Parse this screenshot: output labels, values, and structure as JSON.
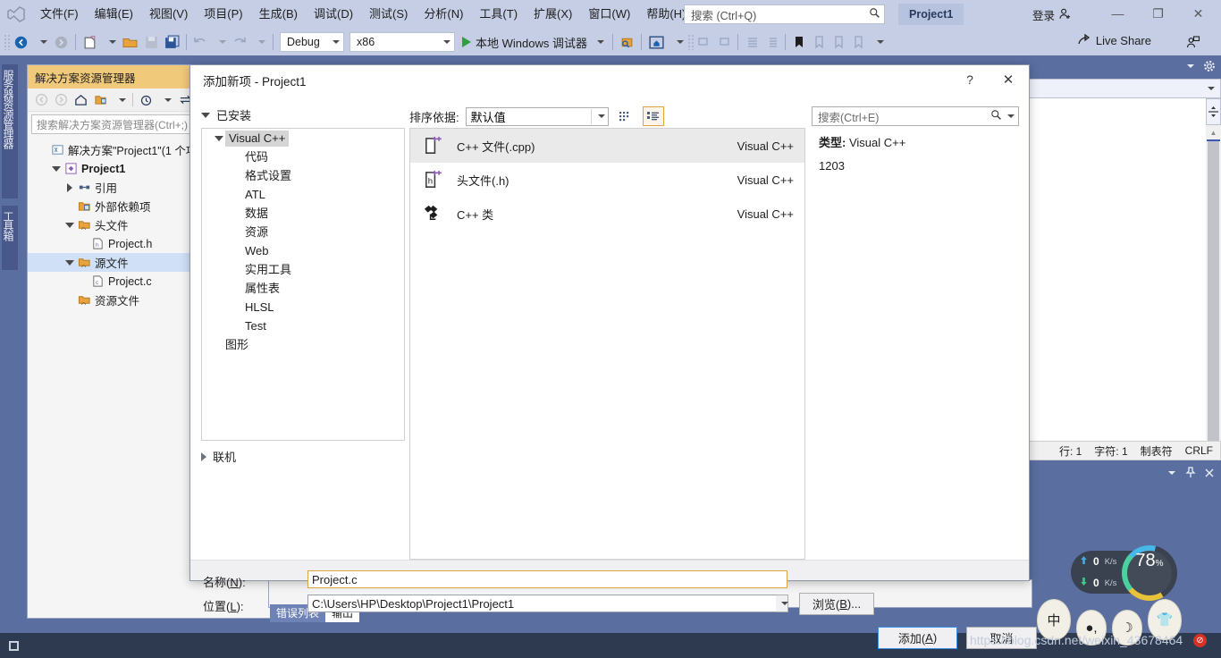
{
  "menubar": {
    "logo_icon": "visual-studio-logo",
    "items": [
      {
        "label": "文件(F)"
      },
      {
        "label": "编辑(E)"
      },
      {
        "label": "视图(V)"
      },
      {
        "label": "项目(P)"
      },
      {
        "label": "生成(B)"
      },
      {
        "label": "调试(D)"
      },
      {
        "label": "测试(S)"
      },
      {
        "label": "分析(N)"
      },
      {
        "label": "工具(T)"
      },
      {
        "label": "扩展(X)"
      },
      {
        "label": "窗口(W)"
      },
      {
        "label": "帮助(H)"
      }
    ],
    "quick_search_placeholder": "搜索 (Ctrl+Q)",
    "project_tab": "Project1",
    "signin_label": "登录",
    "window_minimize": "—",
    "window_maximize": "❐",
    "window_close": "✕"
  },
  "toolbar": {
    "config": "Debug",
    "platform": "x86",
    "run_label": "本地 Windows 调试器",
    "live_share": "Live Share"
  },
  "vertical_tabs": [
    {
      "label": "服务器资源管理器"
    },
    {
      "label": "工具箱"
    }
  ],
  "solution_explorer": {
    "title": "解决方案资源管理器",
    "search_placeholder": "搜索解决方案资源管理器(Ctrl+;)",
    "tree": [
      {
        "label": "解决方案\"Project1\"(1 个项目)",
        "indent": 0,
        "twisty": "",
        "icon": "solution-icon",
        "bold": false,
        "selected": false
      },
      {
        "label": "Project1",
        "indent": 1,
        "twisty": "down",
        "icon": "project-icon",
        "bold": true,
        "selected": false
      },
      {
        "label": "引用",
        "indent": 2,
        "twisty": "right",
        "icon": "references-icon",
        "bold": false,
        "selected": false
      },
      {
        "label": "外部依赖项",
        "indent": 2,
        "twisty": "",
        "icon": "folder-ext-icon",
        "bold": false,
        "selected": false
      },
      {
        "label": "头文件",
        "indent": 2,
        "twisty": "down",
        "icon": "filter-folder-icon",
        "bold": false,
        "selected": false
      },
      {
        "label": "Project.h",
        "indent": 3,
        "twisty": "",
        "icon": "header-file-icon",
        "bold": false,
        "selected": false
      },
      {
        "label": "源文件",
        "indent": 2,
        "twisty": "down",
        "icon": "filter-folder-icon",
        "bold": false,
        "selected": true
      },
      {
        "label": "Project.c",
        "indent": 3,
        "twisty": "",
        "icon": "c-file-icon",
        "bold": false,
        "selected": false
      },
      {
        "label": "资源文件",
        "indent": 2,
        "twisty": "",
        "icon": "filter-folder-icon",
        "bold": false,
        "selected": false
      }
    ]
  },
  "dialog": {
    "title": "添加新项 - Project1",
    "help_button": "?",
    "close_button": "✕",
    "installed_header": "已安装",
    "categories": [
      {
        "label": "Visual C++",
        "indent": 0,
        "twisty": "down",
        "selected": true
      },
      {
        "label": "代码",
        "indent": 1,
        "twisty": "",
        "selected": false
      },
      {
        "label": "格式设置",
        "indent": 1,
        "twisty": "",
        "selected": false
      },
      {
        "label": "ATL",
        "indent": 1,
        "twisty": "",
        "selected": false
      },
      {
        "label": "数据",
        "indent": 1,
        "twisty": "",
        "selected": false
      },
      {
        "label": "资源",
        "indent": 1,
        "twisty": "",
        "selected": false
      },
      {
        "label": "Web",
        "indent": 1,
        "twisty": "",
        "selected": false
      },
      {
        "label": "实用工具",
        "indent": 1,
        "twisty": "",
        "selected": false
      },
      {
        "label": "属性表",
        "indent": 1,
        "twisty": "",
        "selected": false
      },
      {
        "label": "HLSL",
        "indent": 1,
        "twisty": "",
        "selected": false
      },
      {
        "label": "Test",
        "indent": 1,
        "twisty": "",
        "selected": false
      },
      {
        "label": "图形",
        "indent": 0,
        "twisty": "",
        "selected": false
      }
    ],
    "online_label": "联机",
    "sort_label": "排序依据:",
    "sort_value": "默认值",
    "view_grid_icon": "grid-view-icon",
    "view_list_icon": "list-view-icon",
    "templates": [
      {
        "name": "C++ 文件(.cpp)",
        "source": "Visual C++",
        "icon": "cpp-file-icon",
        "selected": true
      },
      {
        "name": "头文件(.h)",
        "source": "Visual C++",
        "icon": "h-file-icon",
        "selected": false
      },
      {
        "name": "C++ 类",
        "source": "Visual C++",
        "icon": "cpp-class-icon",
        "selected": false
      }
    ],
    "detail_search_placeholder": "搜索(Ctrl+E)",
    "detail_type_label": "类型:",
    "detail_type_value": "Visual C++",
    "detail_extra": "1203",
    "name_label": "名称(N):",
    "name_value": "Project.c",
    "location_label": "位置(L):",
    "location_value": "C:\\Users\\HP\\Desktop\\Project1\\Project1",
    "browse_button": "浏览(B)...",
    "add_button": "添加(A)",
    "cancel_button": "取消"
  },
  "editor_panel": {
    "status": {
      "line": "行: 1",
      "char": "字符: 1",
      "tabs": "制表符",
      "eol": "CRLF"
    },
    "gear_icon": "gear-icon",
    "dropdown_icon": "chevron-down-icon",
    "pin_icon": "pin-icon",
    "close_icon": "close-icon"
  },
  "output_window": {
    "tabs": [
      {
        "label": "错误列表",
        "state": "selected"
      },
      {
        "label": "输出",
        "state": "active"
      }
    ]
  },
  "statusbar": {
    "ready_icon": "stop-square-icon"
  },
  "overlays": {
    "net_up": {
      "value": "0",
      "unit": "K/s",
      "arrow": "up-arrow-icon"
    },
    "net_down": {
      "value": "0",
      "unit": "K/s",
      "arrow": "down-arrow-icon"
    },
    "cpu_percent": "78",
    "cpu_percent_symbol": "%",
    "pets": [
      "中",
      "●,",
      "☽",
      "👕"
    ],
    "watermark": "https://blog.csdn.net/weixin_43678464",
    "watermark_badge": "⊘"
  },
  "colors": {
    "chrome": "#c5cee4",
    "workspace": "#5b6ea0",
    "accent_gold": "#f0c97a",
    "accent_blue": "#3b8fe0",
    "statusbar": "#2d3a4f",
    "selection": "#cfe0f7"
  }
}
